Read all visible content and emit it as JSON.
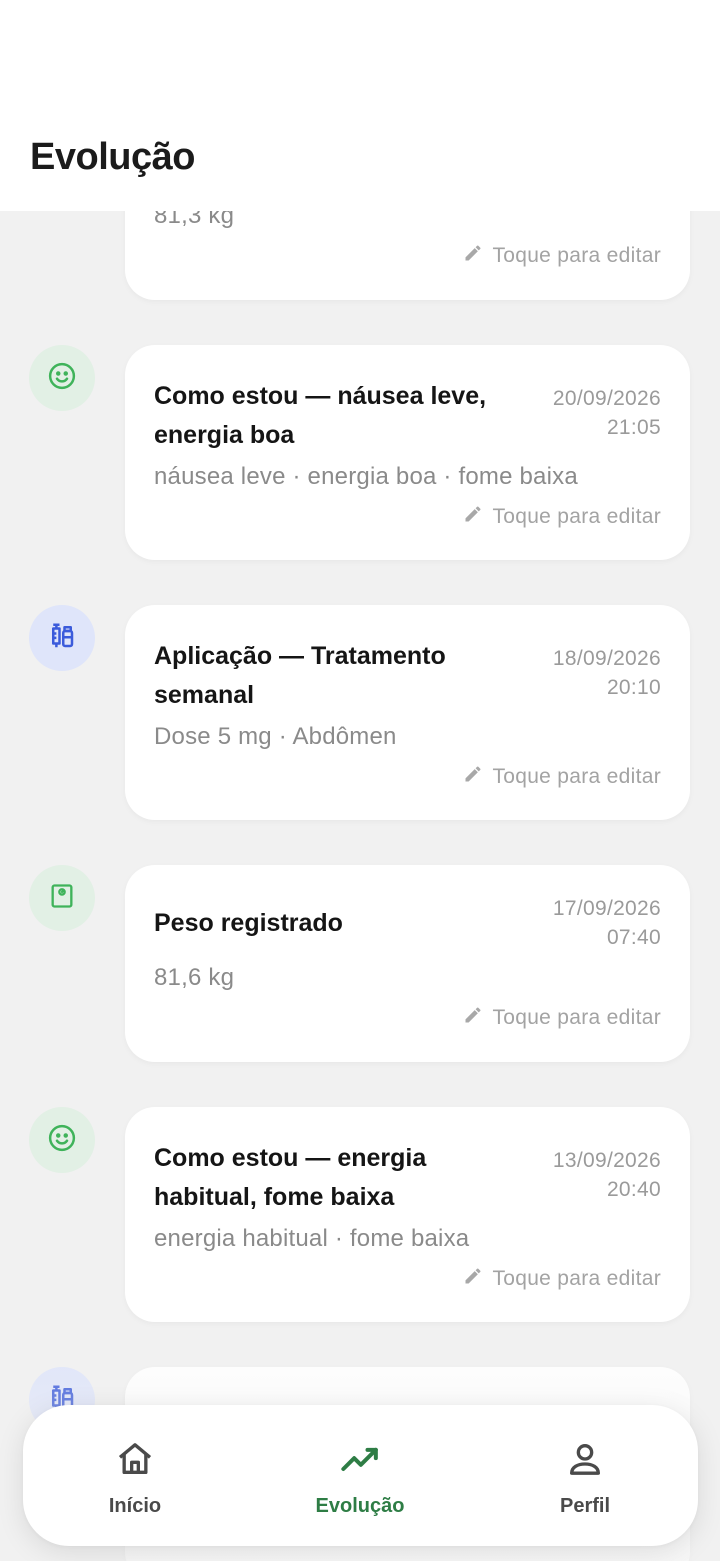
{
  "page": {
    "title": "Evolução"
  },
  "edit_label": "Toque para editar",
  "entries": [
    {
      "kind": "weight",
      "title": "",
      "date": "",
      "time": "",
      "detail": "81,3 kg"
    },
    {
      "kind": "mood",
      "title": "Como estou — náusea leve, energia boa",
      "date": "20/09/2026",
      "time": "21:05",
      "detail": "náusea leve · energia boa · fome baixa"
    },
    {
      "kind": "injection",
      "title": "Aplicação — Tratamento semanal",
      "date": "18/09/2026",
      "time": "20:10",
      "detail": "Dose 5 mg · Abdômen"
    },
    {
      "kind": "weight",
      "title": "Peso registrado",
      "date": "17/09/2026",
      "time": "07:40",
      "detail": "81,6 kg"
    },
    {
      "kind": "mood",
      "title": "Como estou — energia habitual, fome baixa",
      "date": "13/09/2026",
      "time": "20:40",
      "detail": "energia habitual · fome baixa"
    },
    {
      "kind": "injection",
      "title": "",
      "date": "",
      "time": "",
      "detail": ""
    }
  ],
  "nav": {
    "items": [
      {
        "label": "Início",
        "icon": "home-icon",
        "active": false
      },
      {
        "label": "Evolução",
        "icon": "trend-icon",
        "active": true
      },
      {
        "label": "Perfil",
        "icon": "user-icon",
        "active": false
      }
    ]
  },
  "colors": {
    "accent": "#2e7d45",
    "mood_icon": "#3fb35a",
    "injection_icon": "#3b5bdb",
    "background": "#f1f1f1"
  }
}
